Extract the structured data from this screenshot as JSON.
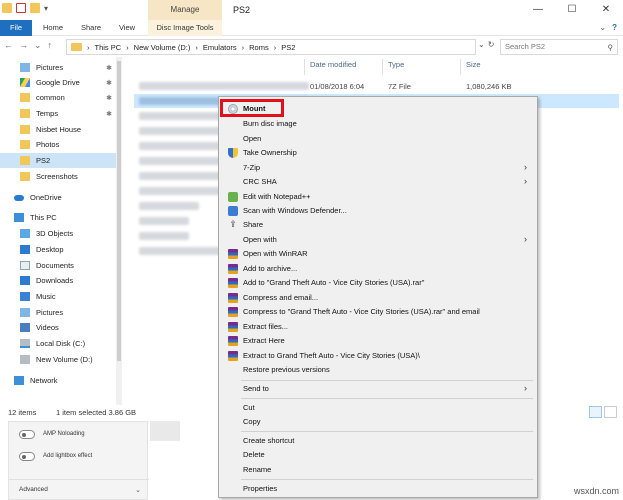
{
  "window": {
    "title": "PS2",
    "manage_tab": "Manage",
    "minimize": "—",
    "maximize": "☐",
    "close": "✕"
  },
  "ribbon": {
    "tabs": [
      "File",
      "Home",
      "Share",
      "View",
      "Disc Image Tools"
    ],
    "expand": "⌄",
    "help": "?"
  },
  "address": {
    "back": "←",
    "forward": "→",
    "dropdown": "⌄",
    "up": "↑",
    "crumbs": [
      "This PC",
      "New Volume (D:)",
      "Emulators",
      "Roms",
      "PS2"
    ],
    "refresh": "↻",
    "search_placeholder": "Search PS2",
    "search_icon": "⚲"
  },
  "nav": {
    "items": [
      {
        "label": "Pictures",
        "icon": "pictures-icon",
        "pinned": true
      },
      {
        "label": "Google Drive",
        "icon": "google-drive-icon",
        "pinned": true
      },
      {
        "label": "common",
        "icon": "folder-icon",
        "pinned": true
      },
      {
        "label": "Temps",
        "icon": "folder-icon",
        "pinned": true
      },
      {
        "label": "Nisbet House",
        "icon": "folder-icon",
        "pinned": false
      },
      {
        "label": "Photos",
        "icon": "folder-icon",
        "pinned": false
      },
      {
        "label": "PS2",
        "icon": "folder-icon",
        "pinned": false
      },
      {
        "label": "Screenshots",
        "icon": "folder-icon",
        "pinned": false
      },
      {
        "label": "OneDrive",
        "icon": "onedrive-icon",
        "pinned": false
      },
      {
        "label": "This PC",
        "icon": "this-pc-icon",
        "pinned": false
      },
      {
        "label": "3D Objects",
        "icon": "3d-objects-icon",
        "pinned": false
      },
      {
        "label": "Desktop",
        "icon": "desktop-icon",
        "pinned": false
      },
      {
        "label": "Documents",
        "icon": "documents-icon",
        "pinned": false
      },
      {
        "label": "Downloads",
        "icon": "downloads-icon",
        "pinned": false
      },
      {
        "label": "Music",
        "icon": "music-icon",
        "pinned": false
      },
      {
        "label": "Pictures",
        "icon": "pictures-icon",
        "pinned": false
      },
      {
        "label": "Videos",
        "icon": "videos-icon",
        "pinned": false
      },
      {
        "label": "Local Disk (C:)",
        "icon": "drive-icon",
        "pinned": false
      },
      {
        "label": "New Volume (D:)",
        "icon": "drive-icon",
        "pinned": false
      },
      {
        "label": "Network",
        "icon": "network-icon",
        "pinned": false
      }
    ],
    "pin_glyph": "📌"
  },
  "filelist": {
    "columns": [
      "Date modified",
      "Type",
      "Size"
    ],
    "rows": [
      {
        "date": "01/08/2018 6:04",
        "type": "7Z File",
        "size": "1,080,246 KB"
      },
      {
        "date": "",
        "type": "",
        "size": ""
      },
      {
        "date": "",
        "type": "",
        "size": ""
      },
      {
        "date": "",
        "type": "",
        "size": ""
      },
      {
        "date": "",
        "type": "",
        "size": ""
      },
      {
        "date": "",
        "type": "",
        "size": ""
      },
      {
        "date": "",
        "type": "",
        "size": ""
      },
      {
        "date": "",
        "type": "",
        "size": ""
      },
      {
        "date": "",
        "type": "",
        "size": ""
      },
      {
        "date": "",
        "type": "",
        "size": ""
      },
      {
        "date": "",
        "type": "",
        "size": ""
      },
      {
        "date": "",
        "type": "",
        "size": ""
      },
      {
        "date": "",
        "type": "",
        "size": ""
      }
    ]
  },
  "status": {
    "item_count": "12 items",
    "selection": "1 item selected  3.86 GB"
  },
  "settings": {
    "toggle1_label": "AMP Noloading",
    "toggle2_label": "Add lightbox effect",
    "advanced_label": "Advanced",
    "advanced_chevron": "⌄"
  },
  "context_menu": {
    "items": [
      {
        "label": "Mount",
        "icon": "disc-icon",
        "bold": true
      },
      {
        "label": "Burn disc image",
        "icon": ""
      },
      {
        "label": "Open",
        "icon": ""
      },
      {
        "label": "Take Ownership",
        "icon": "shield-icon"
      },
      {
        "label": "7-Zip",
        "icon": "",
        "submenu": true
      },
      {
        "label": "CRC SHA",
        "icon": "",
        "submenu": true
      },
      {
        "label": "Edit with Notepad++",
        "icon": "notepad-icon"
      },
      {
        "label": "Scan with Windows Defender...",
        "icon": "defender-icon"
      },
      {
        "label": "Share",
        "icon": "share-icon"
      },
      {
        "label": "Open with",
        "icon": "",
        "submenu": true
      },
      {
        "label": "Open with WinRAR",
        "icon": "winrar-icon"
      },
      {
        "label": "Add to archive...",
        "icon": "winrar-icon"
      },
      {
        "label": "Add to \"Grand Theft Auto - Vice City Stories (USA).rar\"",
        "icon": "winrar-icon"
      },
      {
        "label": "Compress and email...",
        "icon": "winrar-icon"
      },
      {
        "label": "Compress to \"Grand Theft Auto - Vice City Stories (USA).rar\" and email",
        "icon": "winrar-icon"
      },
      {
        "label": "Extract files...",
        "icon": "winrar-icon"
      },
      {
        "label": "Extract Here",
        "icon": "winrar-icon"
      },
      {
        "label": "Extract to Grand Theft Auto - Vice City Stories (USA)\\",
        "icon": "winrar-icon"
      },
      {
        "label": "Restore previous versions",
        "icon": ""
      },
      {
        "label": "Send to",
        "icon": "",
        "submenu": true
      },
      {
        "label": "Cut",
        "icon": ""
      },
      {
        "label": "Copy",
        "icon": ""
      },
      {
        "label": "Create shortcut",
        "icon": ""
      },
      {
        "label": "Delete",
        "icon": ""
      },
      {
        "label": "Rename",
        "icon": ""
      },
      {
        "label": "Properties",
        "icon": ""
      }
    ],
    "arrow_glyph": "›",
    "share_glyph": "⇪"
  },
  "watermark": "wsxdn.com",
  "colors": {
    "file_tab": "#1e6fbf",
    "manage_ctx": "#f6e6c6",
    "selection": "#cce4f7",
    "highlight_box": "#e0111a",
    "menu_bg": "#f0f0f0"
  }
}
